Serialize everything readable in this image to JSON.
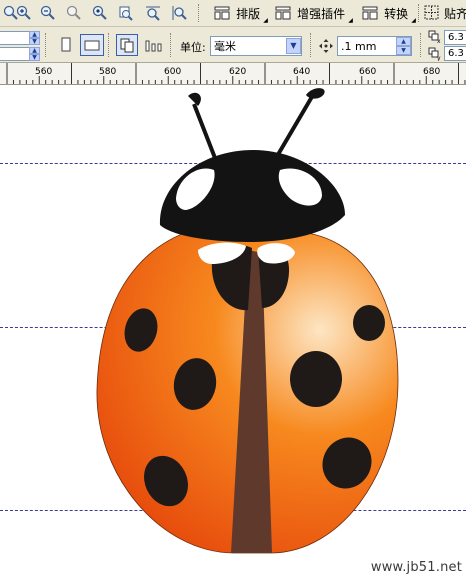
{
  "toolbar_top": {
    "buttons": [
      {
        "label": "排版",
        "icon": "layout-icon"
      },
      {
        "label": "增强插件",
        "icon": "plugin-icon"
      },
      {
        "label": "转换",
        "icon": "convert-icon"
      },
      {
        "label": "贴齐",
        "icon": "snap-icon"
      }
    ],
    "zoom_icons": [
      "zoom-in-icon",
      "zoom-out-icon",
      "zoom-selected-icon",
      "zoom-all-icon",
      "zoom-page-icon",
      "zoom-width-icon",
      "zoom-height-icon"
    ]
  },
  "property_bar": {
    "unit_label": "单位:",
    "unit_value": "毫米",
    "nudge_value": ".1 mm",
    "duplicate_x": "6.3",
    "duplicate_y": "6.3"
  },
  "ruler": {
    "labels": [
      "560",
      "580",
      "600",
      "620",
      "640",
      "660",
      "680"
    ]
  },
  "illustration": {
    "subject": "ladybug",
    "colors": {
      "body_light": "#fde6c4",
      "body_mid": "#f7891e",
      "body_dark": "#e23a08",
      "spots": "#1f1a17",
      "head": "#131313",
      "stripe": "#5f3a2c",
      "eyes": "#ffffff"
    }
  },
  "watermark": "www.jb51.net"
}
